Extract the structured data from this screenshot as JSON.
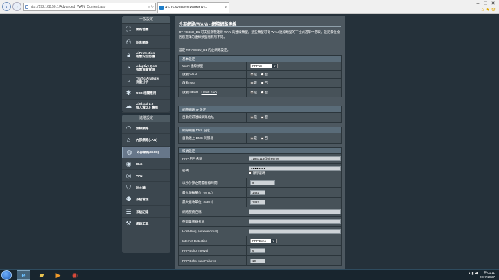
{
  "browser": {
    "address": "http://192.168.50.1/Advanced_WAN_Content.asp",
    "tab_title": "ASUS Wireless Router RT-...",
    "back_icon": "back-arrow-icon",
    "tab_close": "×"
  },
  "sidebar": {
    "general_header": "一般設定",
    "general_items": [
      {
        "label": "網路地圖",
        "icon": "network-map-icon"
      },
      {
        "label": "訪客網路",
        "icon": "guest-network-icon"
      },
      {
        "label": "AiProtection\n智慧安全防護",
        "icon": "lock-icon"
      },
      {
        "label": "Adaptive QoS\n智慧流量管理",
        "icon": "gauge-icon"
      },
      {
        "label": "Traffic Analyzer\n流量分析",
        "icon": "analyzer-icon"
      },
      {
        "label": "USB 相關應用",
        "icon": "puzzle-icon"
      },
      {
        "label": "AiCloud 2.0\n個人雲 2.0 應用",
        "icon": "cloud-icon"
      }
    ],
    "advanced_header": "進階設定",
    "advanced_items": [
      {
        "label": "無線網路",
        "icon": "wifi-icon"
      },
      {
        "label": "內部網路(LAN)",
        "icon": "home-icon"
      },
      {
        "label": "外部網路(WAN)",
        "icon": "globe-icon",
        "active": true
      },
      {
        "label": "IPv6",
        "icon": "ipv6-icon"
      },
      {
        "label": "VPN",
        "icon": "vpn-icon"
      },
      {
        "label": "防火牆",
        "icon": "firewall-icon"
      },
      {
        "label": "系統管理",
        "icon": "user-admin-icon"
      },
      {
        "label": "系統記錄",
        "icon": "log-icon"
      },
      {
        "label": "網路工具",
        "icon": "tools-icon"
      }
    ]
  },
  "main": {
    "title": "外部網路(WAN) - 網際網路連線",
    "intro1": "RT-AC86U_B1 可支援數種連線 WAN 的連線類型，這些類型可從 WAN 連線類型的下拉式選單中選取，設定欄位會因您選擇的連線類型而有所不同。",
    "intro2": "設定 RT-AC86U_B1 的之網路設定。",
    "basic": {
      "header": "基本設定",
      "wan_type_label": "WAN 連線類型",
      "wan_type_value": "PPPoE",
      "enable_wan_label": "啟動 WAN",
      "enable_nat_label": "啟動 NAT",
      "enable_upnp_label": "啟動 UPnP",
      "upnp_faq": "UPnP FAQ",
      "yes": "是",
      "no": "否"
    },
    "wan_ip": {
      "header": "網際網路 IP 設定",
      "auto_ip_label": "自動取得連線網路位址",
      "yes": "是",
      "no": "否"
    },
    "wan_dns": {
      "header": "網際網路 DNS 設定",
      "auto_dns_label": "自動連上 DMS 伺服器",
      "yes": "是",
      "no": "否"
    },
    "account": {
      "header": "帳號設定",
      "username_label": "PPP 用戶名稱",
      "username_value": "71947118@hinet.net",
      "password_label": "密碼",
      "password_value": "●●●●●●●●",
      "show_password": "顯示密碼",
      "idle_label": "以秒計算之閒置斷線時間",
      "idle_value": "0",
      "mtu_label": "最大傳輸單位（MTU）",
      "mtu_value": "1492",
      "mru_label": "最大接收單位（MRU）",
      "mru_value": "1492",
      "service_label": "網路服務名稱",
      "access_label": "存取集訊器名稱",
      "host_uniq_label": "Host-Uniq (Hexadecimal)",
      "detection_label": "Internet Detection",
      "detection_value": "PPP Echo",
      "echo_interval_label": "PPP Echo Interval",
      "echo_interval_value": "6",
      "echo_fail_label": "PPP Echo Max Failures",
      "echo_fail_value": "10"
    }
  },
  "taskbar": {
    "time": "上午 01:11",
    "date": "2017/10/27"
  }
}
